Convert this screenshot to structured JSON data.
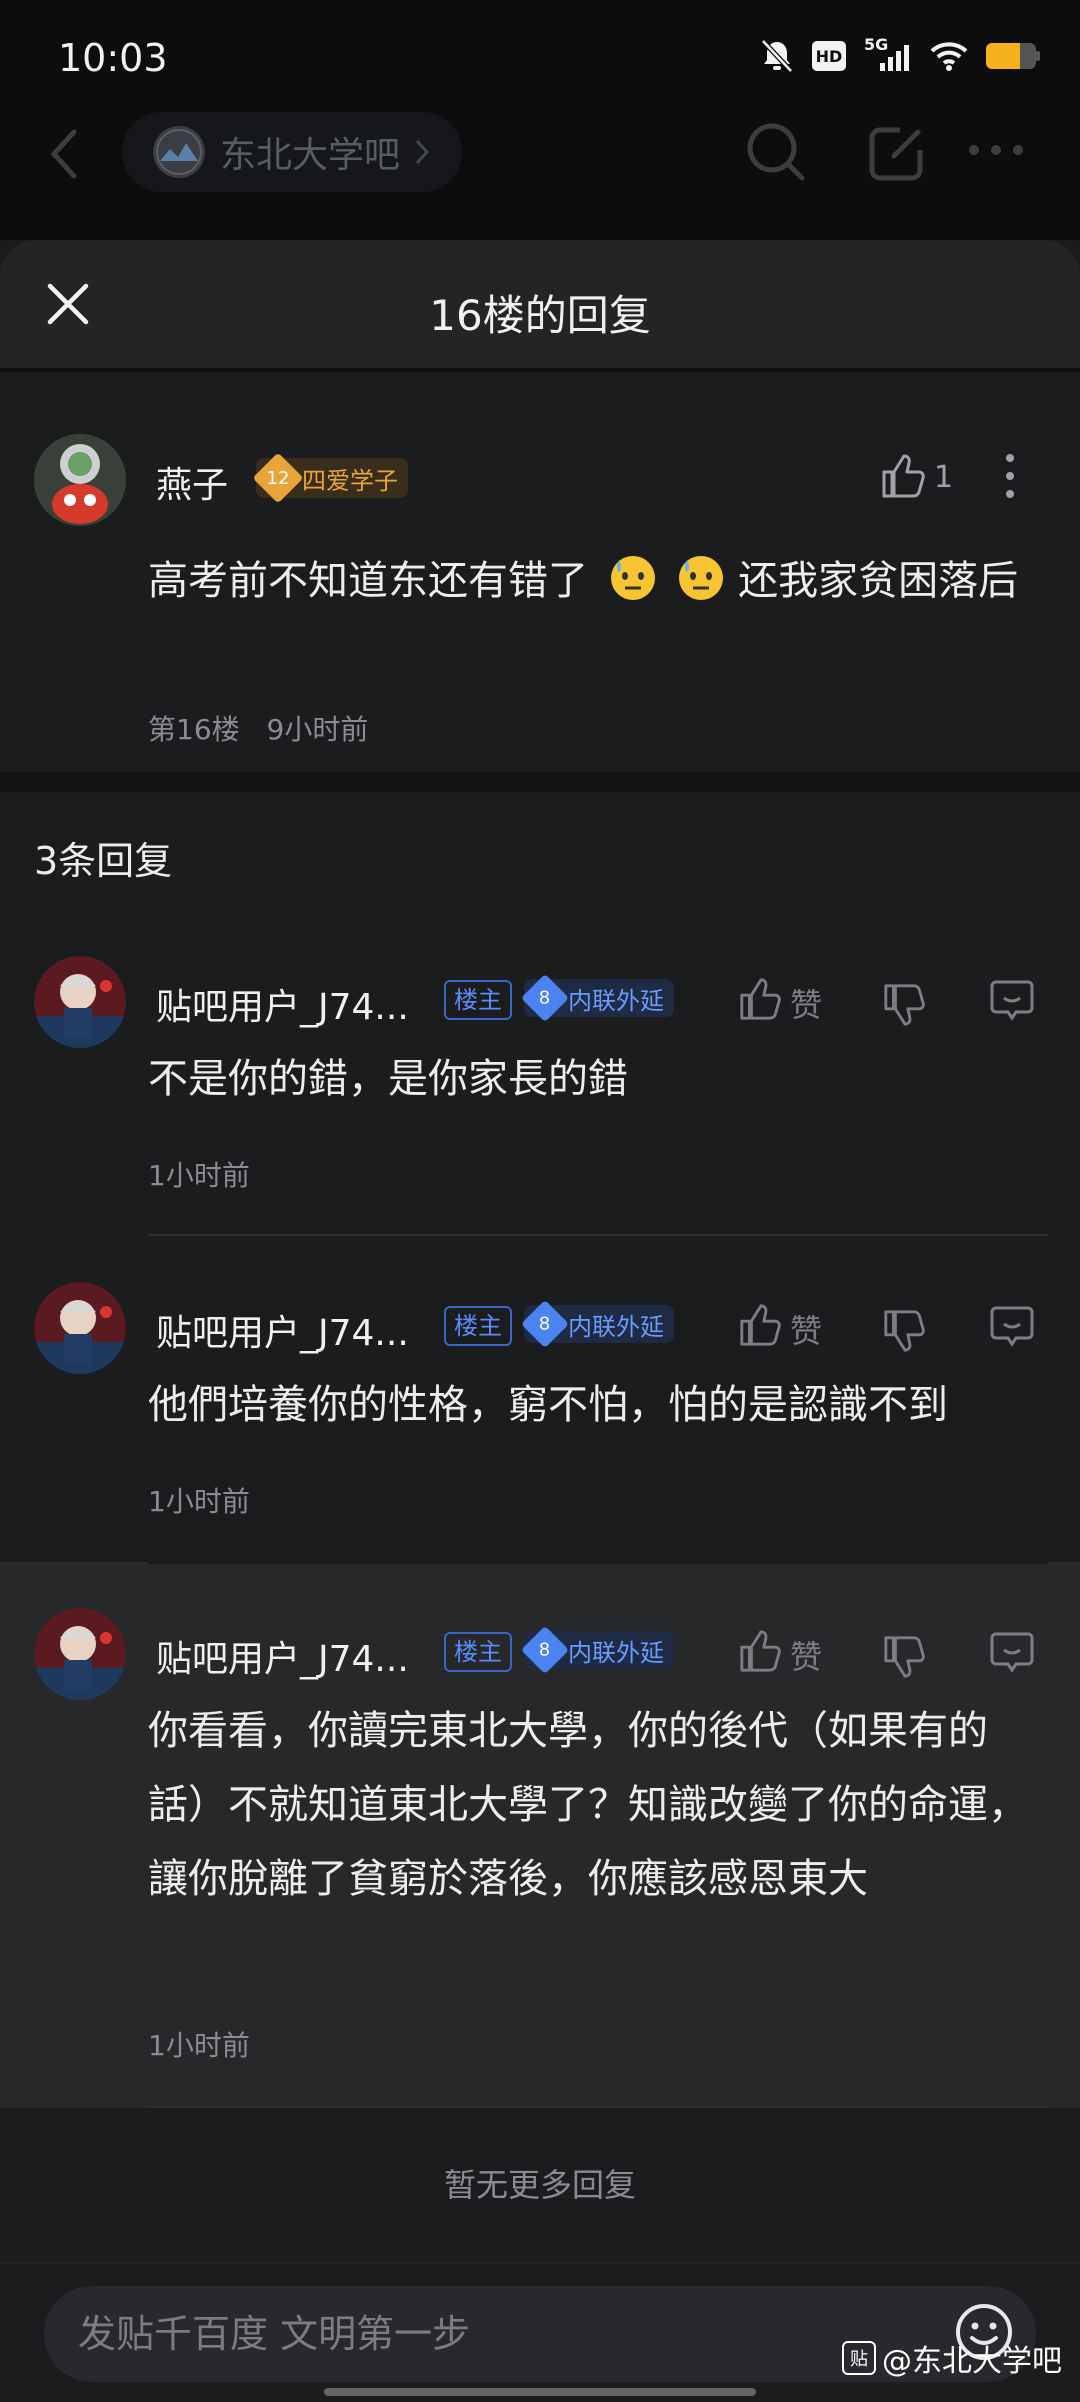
{
  "status_bar": {
    "time": "10:03",
    "network": "5G",
    "hd": "HD"
  },
  "nav": {
    "forum_name": "东北大学吧"
  },
  "sheet": {
    "title": "16楼的回复"
  },
  "main_post": {
    "username": "燕子",
    "level": "12",
    "level_title": "四爱学子",
    "likes": "1",
    "content_part1": "高考前不知道东还有错了",
    "content_part2": "还我家贫困落后",
    "floor": "第16楼",
    "time": "9小时前"
  },
  "reply_count": "3条回复",
  "replies": [
    {
      "username": "贴吧用户_J74...",
      "op_tag": "楼主",
      "level": "8",
      "level_title": "内联外延",
      "like_label": "赞",
      "content": "不是你的錯，是你家長的錯",
      "time": "1小时前"
    },
    {
      "username": "贴吧用户_J74...",
      "op_tag": "楼主",
      "level": "8",
      "level_title": "内联外延",
      "like_label": "赞",
      "content": "他們培養你的性格，窮不怕，怕的是認識不到",
      "time": "1小时前"
    },
    {
      "username": "贴吧用户_J74...",
      "op_tag": "楼主",
      "level": "8",
      "level_title": "内联外延",
      "like_label": "赞",
      "content": "你看看，你讀完東北大學，你的後代（如果有的話）不就知道東北大學了？知識改變了你的命運，讓你脫離了貧窮於落後，你應該感恩東大",
      "time": "1小时前"
    }
  ],
  "no_more": "暂无更多回复",
  "input": {
    "placeholder": "发贴千百度 文明第一步"
  },
  "watermark": {
    "prefix": "贴",
    "text": "@东北大学吧"
  },
  "colors": {
    "accent_gold": "#e8a63a",
    "accent_blue": "#4b83f0",
    "bg": "#1b1c1e"
  }
}
